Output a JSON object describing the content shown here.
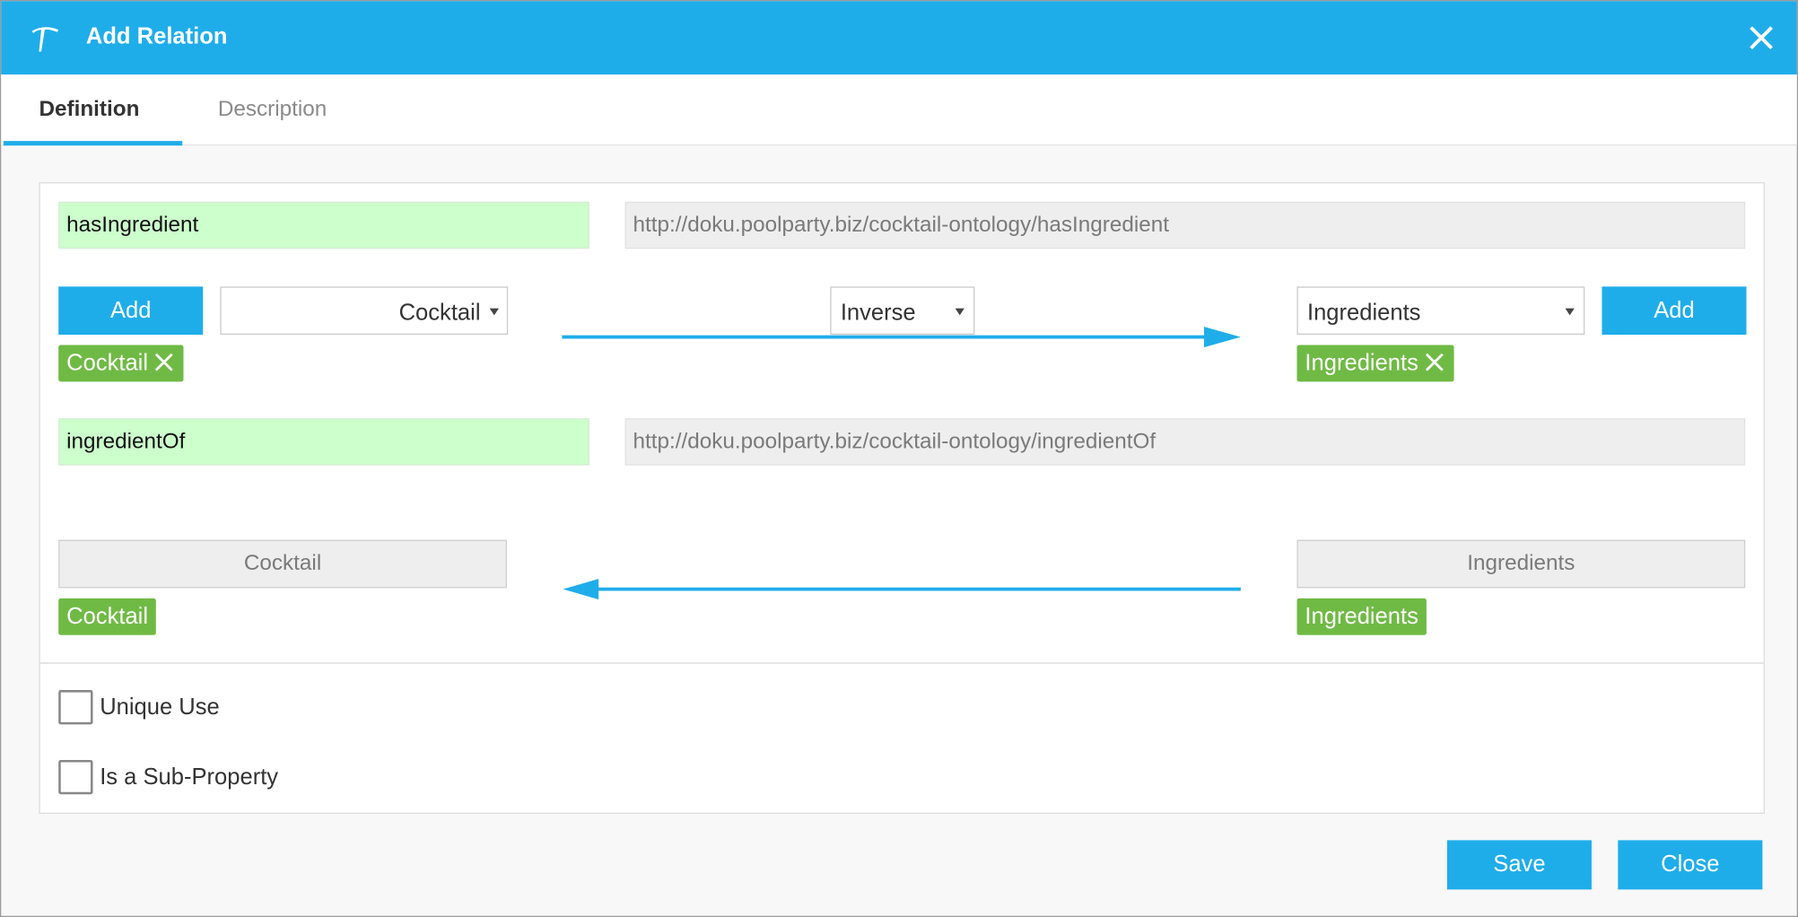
{
  "dialog": {
    "title": "Add Relation",
    "accent_color": "#1fadea",
    "chip_color": "#6fba44",
    "name_field_color": "#ccffcc"
  },
  "tabs": [
    {
      "label": "Definition",
      "active": true
    },
    {
      "label": "Description",
      "active": false
    }
  ],
  "relation": {
    "name": "hasIngredient",
    "uri": "http://doku.poolparty.biz/cocktail-ontology/hasIngredient",
    "add_domain_label": "Add",
    "domain_select": "Cocktail",
    "inverse_select": "Inverse",
    "range_select": "Ingredients",
    "add_range_label": "Add",
    "domain_chip": "Cocktail",
    "range_chip": "Ingredients"
  },
  "inverse": {
    "name": "ingredientOf",
    "uri": "http://doku.poolparty.biz/cocktail-ontology/ingredientOf",
    "domain_box": "Cocktail",
    "range_box": "Ingredients",
    "domain_chip": "Cocktail",
    "range_chip": "Ingredients"
  },
  "options": {
    "unique_use": {
      "label": "Unique Use",
      "checked": false
    },
    "sub_property": {
      "label": "Is a Sub-Property",
      "checked": false
    }
  },
  "footer": {
    "save_label": "Save",
    "close_label": "Close"
  },
  "icons": {
    "app": "pickaxe-icon",
    "close": "close-icon",
    "chip_remove": "close-icon",
    "dropdown": "caret-down-icon"
  }
}
